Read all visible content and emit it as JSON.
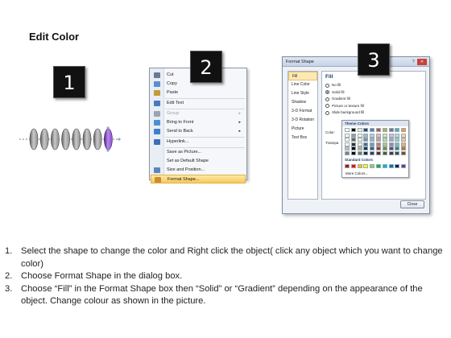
{
  "title": "Edit Color",
  "steps": [
    "1",
    "2",
    "3"
  ],
  "shape_row": {
    "highlight_color": "#8a4fc9",
    "base_color": "#8d8d8d"
  },
  "context_menu": {
    "items": [
      {
        "label": "Cut",
        "icon": "scissors-icon",
        "enabled": true,
        "submenu": false
      },
      {
        "label": "Copy",
        "icon": "copy-icon",
        "enabled": true,
        "submenu": false
      },
      {
        "label": "Paste",
        "icon": "paste-icon",
        "enabled": true,
        "submenu": false
      },
      {
        "label": "Edit Text",
        "icon": "edit-text-icon",
        "enabled": true,
        "submenu": false
      },
      {
        "label": "Group",
        "icon": "group-icon",
        "enabled": false,
        "submenu": true
      },
      {
        "label": "Bring to Front",
        "icon": "bring-front-icon",
        "enabled": true,
        "submenu": true
      },
      {
        "label": "Send to Back",
        "icon": "send-back-icon",
        "enabled": true,
        "submenu": true
      },
      {
        "label": "Hyperlink...",
        "icon": "hyperlink-icon",
        "enabled": true,
        "submenu": false
      },
      {
        "label": "Save as Picture...",
        "icon": "",
        "enabled": true,
        "submenu": false
      },
      {
        "label": "Set as Default Shape",
        "icon": "",
        "enabled": true,
        "submenu": false
      },
      {
        "label": "Size and Position...",
        "icon": "size-position-icon",
        "enabled": true,
        "submenu": false
      },
      {
        "label": "Format Shape...",
        "icon": "format-shape-icon",
        "enabled": true,
        "submenu": false,
        "highlighted": true
      }
    ]
  },
  "dialog": {
    "title": "Format Shape",
    "window_buttons": "?",
    "categories": [
      "Fill",
      "Line Color",
      "Line Style",
      "Shadow",
      "3-D Format",
      "3-D Rotation",
      "Picture",
      "Text Box"
    ],
    "active_category": "Fill",
    "fill_heading": "Fill",
    "fill_options": [
      "No fill",
      "Solid fill",
      "Gradient fill",
      "Picture or texture fill",
      "Slide background fill"
    ],
    "selected_fill": "Solid fill",
    "color_label": "Color:",
    "transparency_label": "Transpa",
    "close_label": "Close"
  },
  "palette": {
    "theme_label": "Theme Colors",
    "standard_label": "Standard Colors",
    "more_label": "More Colors...",
    "theme_top": [
      "#ffffff",
      "#000000",
      "#eeece1",
      "#1f497d",
      "#4f81bd",
      "#c0504d",
      "#9bbb59",
      "#8064a2",
      "#4bacc6",
      "#f79646"
    ],
    "standard": [
      "#c00000",
      "#ff0000",
      "#ffc000",
      "#ffff00",
      "#92d050",
      "#00b050",
      "#00b0f0",
      "#0070c0",
      "#002060",
      "#7030a0"
    ]
  },
  "instructions": [
    {
      "num": "1.",
      "text": "Select the shape to change the color and Right click the object( click any object which you want to change color)"
    },
    {
      "num": "2.",
      "text": "Choose Format Shape in the dialog box."
    },
    {
      "num": "3.",
      "text": "Choose “Fill” in the Format Shape box then “Solid” or “Gradient” depending on the appearance of the object. Change colour as shown in the picture."
    }
  ]
}
